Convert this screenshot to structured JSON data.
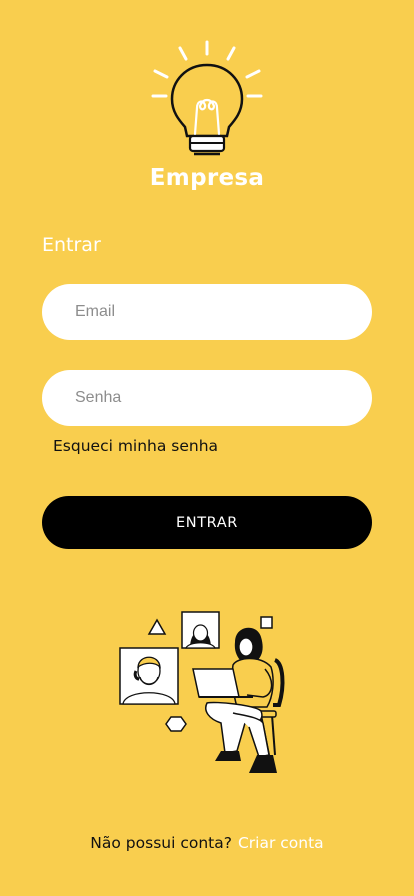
{
  "brand": {
    "name": "Empresa",
    "logo_icon": "lightbulb-icon"
  },
  "login": {
    "title": "Entrar",
    "email_placeholder": "Email",
    "password_placeholder": "Senha",
    "forgot_password": "Esqueci minha senha",
    "submit_label": "ENTRAR"
  },
  "illustration": {
    "icon": "remote-work-illustration"
  },
  "signup": {
    "question": "Não possui conta?",
    "link": "Criar conta"
  },
  "colors": {
    "background": "#F9CE4E",
    "button": "#000000",
    "text_light": "#ffffff"
  }
}
